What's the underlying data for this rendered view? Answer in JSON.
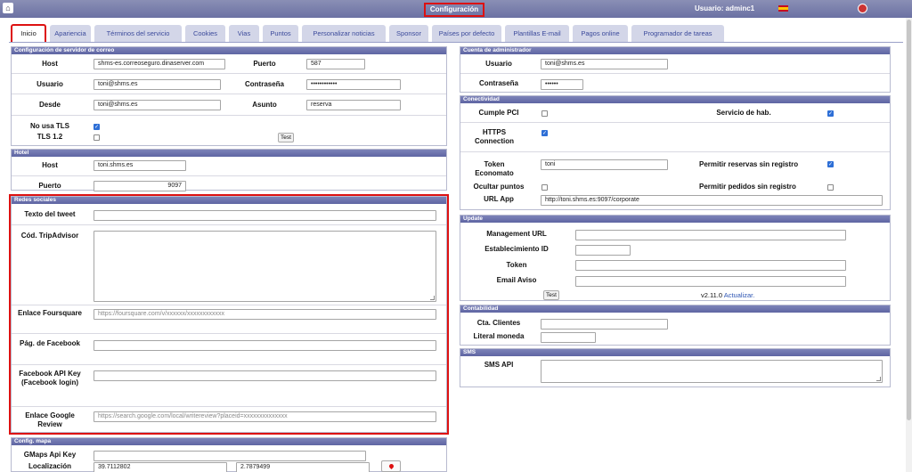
{
  "topbar": {
    "home_icon": "home-icon",
    "title": "Configuración",
    "user": "Usuario: adminc1",
    "flag": "spain-flag-icon",
    "power": "power-icon"
  },
  "tabs": [
    "Inicio",
    "Apariencia",
    "Términos del servicio",
    "Cookies",
    "Vias",
    "Puntos",
    "Personalizar noticias",
    "Sponsor",
    "Países por defecto",
    "Plantillas E-mail",
    "Pagos online",
    "Programador de tareas"
  ],
  "mail": {
    "title": "Configuración de servidor de correo",
    "host_label": "Host",
    "host": "shms-es.correoseguro.dinaserver.com",
    "port_label": "Puerto",
    "port": "587",
    "user_label": "Usuario",
    "user": "toni@shms.es",
    "password_label": "Contraseña",
    "password": "••••••••••••",
    "from_label": "Desde",
    "from": "toni@shms.es",
    "subject_label": "Asunto",
    "subject": "reserva",
    "notls_label": "No usa TLS",
    "tls12_label": "TLS 1.2",
    "test": "Test"
  },
  "hotel": {
    "title": "Hotel",
    "host_label": "Host",
    "host": "toni.shms.es",
    "port_label": "Puerto",
    "port": "9097"
  },
  "social": {
    "title": "Redes sociales",
    "tweet_label": "Texto del tweet",
    "tweet": "",
    "tripadvisor_label": "Cód. TripAdvisor",
    "foursquare_label": "Enlace Foursquare",
    "foursquare_ph": "https://foursquare.com/v/xxxxxx/xxxxxxxxxxxx",
    "facebook_label": "Pág. de Facebook",
    "fbapi_label": "Facebook API Key (Facebook login)",
    "google_label": "Enlace Google Review",
    "google_ph": "https://search.google.com/local/writereview?placeid=xxxxxxxxxxxxxx"
  },
  "map": {
    "title": "Config. mapa",
    "api_label": "GMaps Api Key",
    "loc_label": "Localización",
    "lat": "39.7112802",
    "lng": "2.7879499",
    "pin": "map-pin-icon"
  },
  "admin": {
    "title": "Cuenta de administrador",
    "user_label": "Usuario",
    "user": "toni@shms.es",
    "password_label": "Contraseña",
    "password": "••••••"
  },
  "conn": {
    "title": "Conectividad",
    "pci_label": "Cumple PCI",
    "room_service_label": "Servicio de hab.",
    "https_label": "HTTPS Connection",
    "token_label": "Token Economato",
    "token": "toni",
    "allow_res_label": "Permitir reservas sin registro",
    "hide_points_label": "Ocultar puntos",
    "allow_orders_label": "Permitir pedidos sin registro",
    "url_label": "URL App",
    "url": "http://toni.shms.es:9097/corporate"
  },
  "update": {
    "title": "Update",
    "mgmt_label": "Management URL",
    "est_label": "Establecimiento ID",
    "token_label": "Token",
    "email_label": "Email Aviso",
    "test": "Test",
    "version": "v2.11.0",
    "update_link": "Actualizar."
  },
  "accounting": {
    "title": "Contabilidad",
    "clients_label": "Cta. Clientes",
    "currency_label": "Literal moneda"
  },
  "sms": {
    "title": "SMS",
    "api_label": "SMS API"
  }
}
